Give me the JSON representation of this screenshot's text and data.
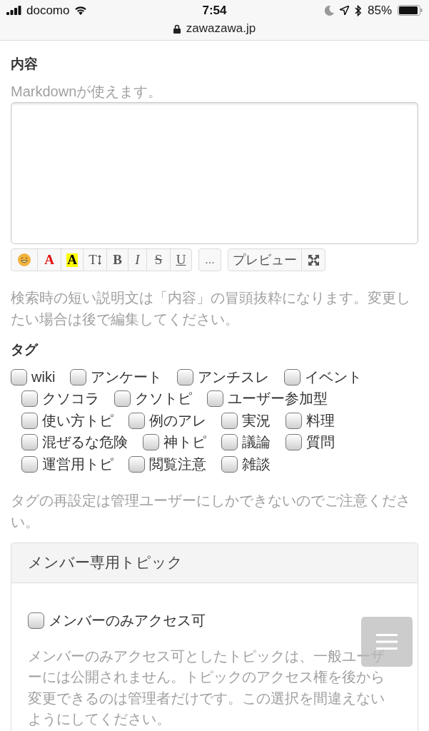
{
  "status_bar": {
    "carrier": "docomo",
    "time": "7:54",
    "battery": "85%",
    "url": "zawazawa.jp"
  },
  "content": {
    "label": "内容",
    "hint": "Markdownが使えます。",
    "toolbar": [
      {
        "buttons": [
          {
            "kind": "emoji"
          },
          {
            "kind": "text-color",
            "label": "A"
          },
          {
            "kind": "highlight",
            "label": "A"
          },
          {
            "kind": "font-size",
            "label": "T"
          },
          {
            "kind": "bold",
            "label": "B"
          },
          {
            "kind": "italic",
            "label": "I"
          },
          {
            "kind": "strike",
            "label": "S"
          },
          {
            "kind": "underline",
            "label": "U"
          }
        ]
      },
      {
        "buttons": [
          {
            "kind": "more",
            "label": "..."
          }
        ]
      },
      {
        "buttons": [
          {
            "kind": "preview",
            "label": "プレビュー"
          },
          {
            "kind": "fullscreen"
          }
        ]
      }
    ],
    "help": "検索時の短い説明文は「内容」の冒頭抜粋になります。変更したい場合は後で編集してください。"
  },
  "tags": {
    "label": "タグ",
    "items": [
      {
        "label": "wiki",
        "checked": false
      },
      {
        "label": "アンケート",
        "checked": false
      },
      {
        "label": "アンチスレ",
        "checked": false
      },
      {
        "label": "イベント",
        "checked": false
      },
      {
        "label": "クソコラ",
        "checked": false
      },
      {
        "label": "クソトピ",
        "checked": false
      },
      {
        "label": "ユーザー参加型",
        "checked": false
      },
      {
        "label": "使い方トピ",
        "checked": false
      },
      {
        "label": "例のアレ",
        "checked": false
      },
      {
        "label": "実況",
        "checked": false
      },
      {
        "label": "料理",
        "checked": false
      },
      {
        "label": "混ぜるな危険",
        "checked": false
      },
      {
        "label": "神トピ",
        "checked": false
      },
      {
        "label": "議論",
        "checked": false
      },
      {
        "label": "質問",
        "checked": false
      },
      {
        "label": "運営用トピ",
        "checked": false
      },
      {
        "label": "閲覧注意",
        "checked": false
      },
      {
        "label": "雑談",
        "checked": false
      }
    ],
    "note": "タグの再設定は管理ユーザーにしかできないのでご注意ください。"
  },
  "member_section": {
    "title": "メンバー専用トピック",
    "option": {
      "label": "メンバーのみアクセス可",
      "checked": false
    },
    "note": "メンバーのみアクセス可としたトピックは、一般ユーザーには公開されません。トピックのアクセス権を後から変更できるのは管理者だけです。この選択を間違えないようにしてください。"
  }
}
